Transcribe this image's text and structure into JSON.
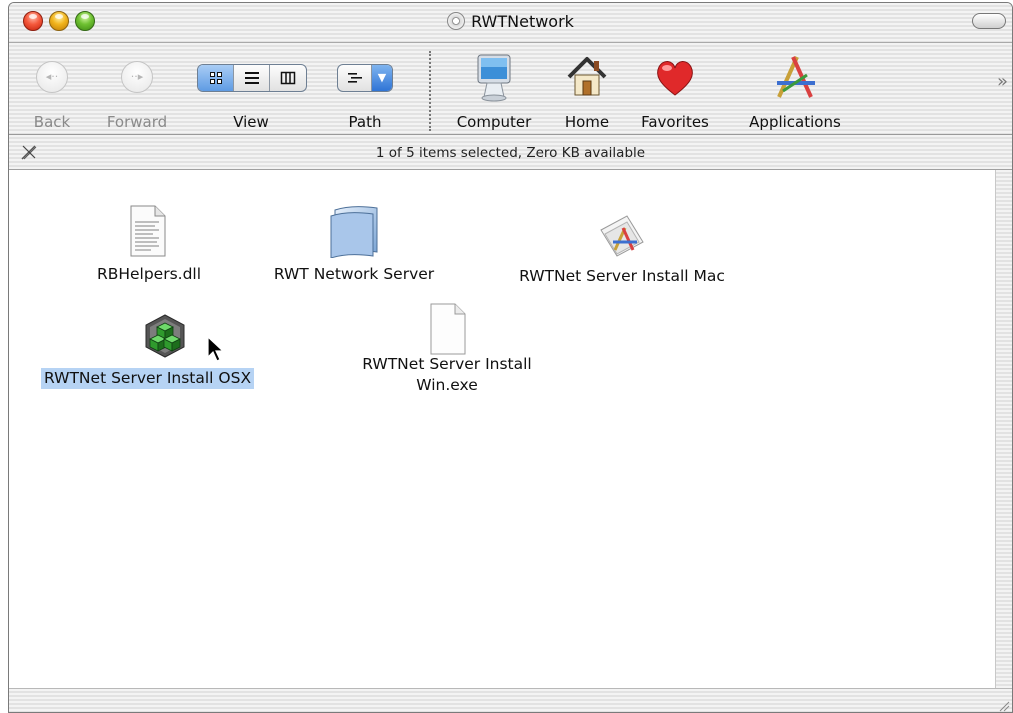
{
  "window": {
    "title": "RWTNetwork"
  },
  "toolbar": {
    "back_label": "Back",
    "forward_label": "Forward",
    "view_label": "View",
    "path_label": "Path",
    "computer_label": "Computer",
    "home_label": "Home",
    "favorites_label": "Favorites",
    "applications_label": "Applications",
    "view_mode_selected": "icon"
  },
  "status": {
    "text": "1 of 5 items selected, Zero KB available"
  },
  "files": [
    {
      "name": "RBHelpers.dll",
      "icon": "document-icon",
      "selected": false
    },
    {
      "name": "RWT Network Server",
      "icon": "folder-icon",
      "selected": false
    },
    {
      "name": "RWTNet Server Install Mac",
      "icon": "installer-app-icon",
      "selected": false
    },
    {
      "name": "RWTNet Server Install OSX",
      "icon": "cube-app-icon",
      "selected": true
    },
    {
      "name_line1": "RWTNet Server Install",
      "name_line2": "Win.exe",
      "icon": "blank-document-icon",
      "selected": false
    }
  ],
  "colors": {
    "selection": "#b6d3f4",
    "accent_blue": "#2f74d6"
  }
}
